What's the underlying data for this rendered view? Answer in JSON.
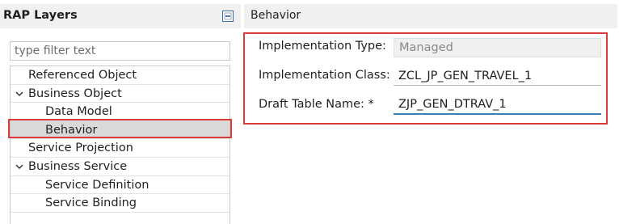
{
  "left_panel": {
    "title": "RAP Layers",
    "collapse_icon": "collapse-all-icon",
    "filter_placeholder": "type filter text",
    "tree": [
      {
        "label": "Referenced Object",
        "level": 0,
        "expanded": null
      },
      {
        "label": "Business Object",
        "level": 0,
        "expanded": true
      },
      {
        "label": "Data Model",
        "level": 1,
        "expanded": null
      },
      {
        "label": "Behavior",
        "level": 1,
        "expanded": null,
        "selected": true
      },
      {
        "label": "Service Projection",
        "level": 0,
        "expanded": null
      },
      {
        "label": "Business Service",
        "level": 0,
        "expanded": true
      },
      {
        "label": "Service Definition",
        "level": 1,
        "expanded": null
      },
      {
        "label": "Service Binding",
        "level": 1,
        "expanded": null
      }
    ]
  },
  "right_panel": {
    "title": "Behavior",
    "fields": [
      {
        "label": "Implementation Type:",
        "value": "Managed",
        "readonly": true
      },
      {
        "label": "Implementation Class: *",
        "value": "ZCL_JP_GEN_TRAVEL_1",
        "readonly": false
      },
      {
        "label": "Draft Table Name: *",
        "value": "ZJP_GEN_DTRAV_1",
        "readonly": false,
        "focused": true
      }
    ]
  },
  "colors": {
    "highlight_outline": "#d93a3a",
    "focus_underline": "#3c7fb1",
    "header_bg": "#f0f0f0",
    "selection_bg": "#d9d9d9"
  }
}
